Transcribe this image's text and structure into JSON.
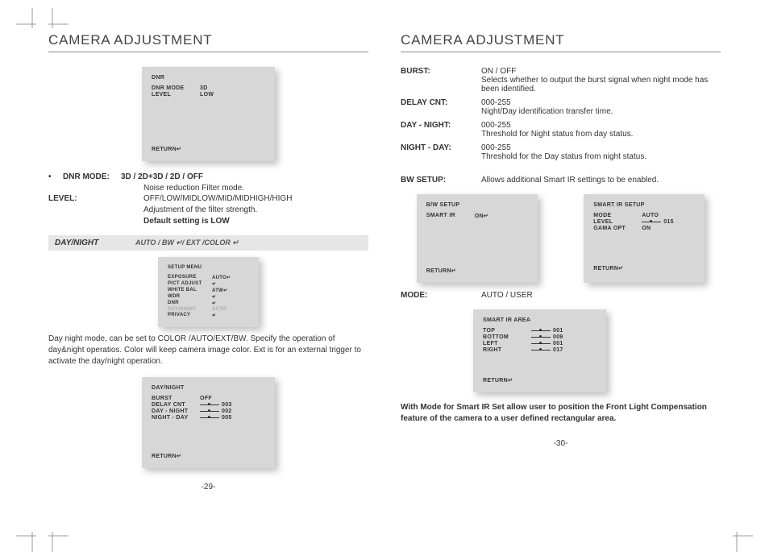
{
  "crop": {},
  "left": {
    "title": "CAMERA ADJUSTMENT",
    "dnr_box": {
      "title": "DNR",
      "rows": [
        {
          "k": "DNR MODE",
          "v": "3D"
        },
        {
          "k": "LEVEL",
          "v": "LOW"
        }
      ],
      "return": "RETURN↵"
    },
    "dnr_params": {
      "bullet_label": "DNR MODE:",
      "bullet_value": "3D / 2D+3D / 2D / OFF",
      "bullet_sub": "Noise reduction Filter mode.",
      "level_label": "LEVEL:",
      "level_value": "OFF/LOW/MIDLOW/MID/MIDHIGH/HIGH",
      "level_sub1": "Adjustment of the filter strength.",
      "level_sub2": "Default setting is LOW"
    },
    "daynight_bar": {
      "label": "DAY/NIGHT",
      "opts": "AUTO / BW ↵/ EXT /COLOR ↵"
    },
    "setup_box": {
      "title": "SETUP MENU",
      "rows": [
        {
          "k": "EXPOSURE",
          "v": "AUTO↵"
        },
        {
          "k": "PICT ADJUST",
          "v": "↵"
        },
        {
          "k": "WHITE BAL",
          "v": "ATW↵"
        },
        {
          "k": "WDR",
          "v": "↵"
        },
        {
          "k": "DNR",
          "v": "↵"
        },
        {
          "k": "DAY/NIGHT",
          "v": "AUTO",
          "faded": true
        },
        {
          "k": "PRIVACY",
          "v": "↵"
        }
      ]
    },
    "daynight_desc": "Day night mode, can be set to COLOR /AUTO/EXT/BW. Specify the operation of day&night operatios. Color will keep camera image color. Ext is for an external trigger to activate the day/night operation.",
    "daynight_box": {
      "title": "DAY/NIGHT",
      "rows": [
        {
          "k": "BURST",
          "v": "OFF"
        },
        {
          "k": "DELAY CNT",
          "slider": true,
          "num": "003"
        },
        {
          "k": "DAY - NIGHT",
          "slider": true,
          "num": "002"
        },
        {
          "k": "NIGHT - DAY",
          "slider": true,
          "num": "005"
        }
      ],
      "return": "RETURN↵"
    },
    "page_num": "-29-"
  },
  "right": {
    "title": "CAMERA ADJUSTMENT",
    "params": [
      {
        "k": "BURST:",
        "v": "ON / OFF",
        "sub": "Selects whether to output the burst signal when night mode has been identified."
      },
      {
        "k": "DELAY CNT:",
        "v": "000-255",
        "sub": "Night/Day identification transfer time."
      },
      {
        "k": "DAY - NIGHT:",
        "v": "000-255",
        "sub": "Threshold for Night status from day status."
      },
      {
        "k": "NIGHT - DAY:",
        "v": "000-255",
        "sub": "Threshold for the Day status from night status."
      }
    ],
    "bw_setup": {
      "k": "BW SETUP:",
      "v": "Allows additional Smart IR settings to be enabled."
    },
    "bw_box": {
      "title": "B/W SETUP",
      "rows": [
        {
          "k": "SMART IR",
          "v": "ON↵"
        }
      ],
      "return": "RETURN↵"
    },
    "smartir_box": {
      "title": "SMART IR SETUP",
      "rows": [
        {
          "k": "MODE",
          "v": "AUTO"
        },
        {
          "k": "LEVEL",
          "slider": true,
          "num": "015"
        },
        {
          "k": "GAMA OPT",
          "v": "ON"
        }
      ],
      "return": "RETURN↵"
    },
    "mode_row": {
      "k": "MODE:",
      "v": "AUTO / USER"
    },
    "area_box": {
      "title": "SMART IR AREA",
      "rows": [
        {
          "k": "TOP",
          "slider": true,
          "num": "001"
        },
        {
          "k": "BOTTOM",
          "slider": true,
          "num": "009"
        },
        {
          "k": "LEFT",
          "slider": true,
          "num": "001"
        },
        {
          "k": "RIGHT",
          "slider": true,
          "num": "017"
        }
      ],
      "return": "RETURN↵"
    },
    "footer": "With Mode for Smart IR Set allow user to position the Front Light Compensation feature of the camera to a user defined rectangular area.",
    "page_num": "-30-"
  }
}
